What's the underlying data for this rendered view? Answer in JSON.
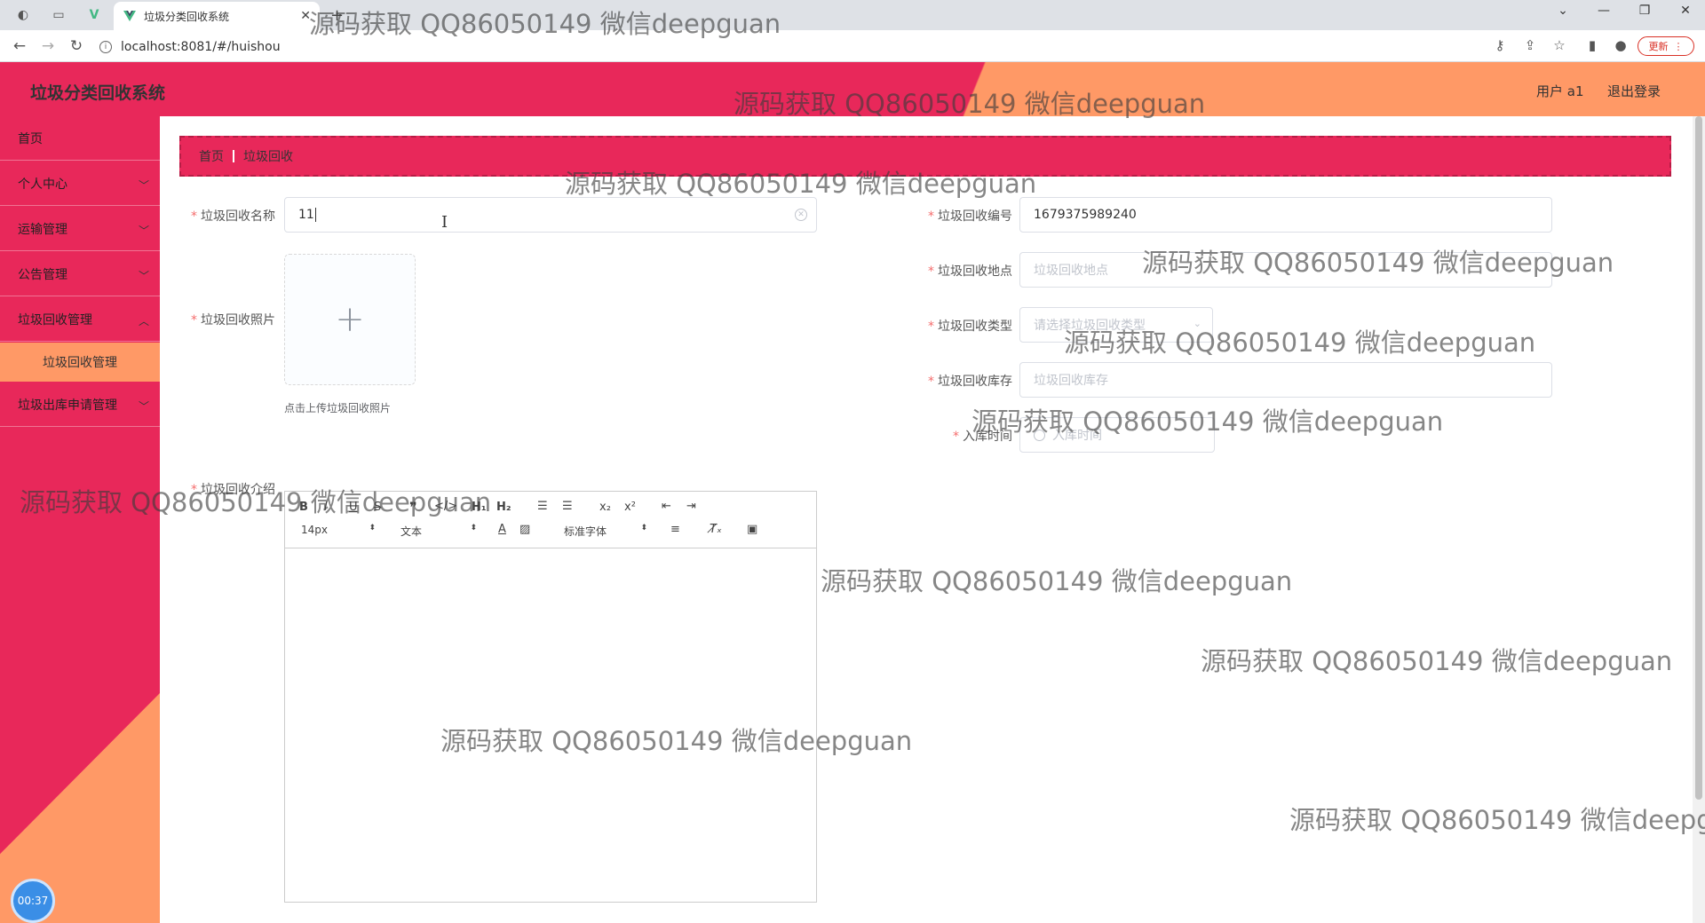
{
  "browser": {
    "tab_title": "垃圾分类回收系统",
    "url": "localhost:8081/#/huishou",
    "update_label": "更新"
  },
  "header": {
    "app_title": "垃圾分类回收系统",
    "user_label": "用户 a1",
    "logout_label": "退出登录"
  },
  "sidebar": {
    "items": [
      {
        "label": "首页",
        "expandable": false
      },
      {
        "label": "个人中心",
        "expandable": true
      },
      {
        "label": "运输管理",
        "expandable": true
      },
      {
        "label": "公告管理",
        "expandable": true
      },
      {
        "label": "垃圾回收管理",
        "expandable": true
      },
      {
        "label": "垃圾出库申请管理",
        "expandable": true
      }
    ],
    "active_sub_item": "垃圾回收管理",
    "timer": "00:37"
  },
  "breadcrumb": [
    "首页",
    "垃圾回收"
  ],
  "form": {
    "name": {
      "label": "垃圾回收名称",
      "value": "11"
    },
    "photo": {
      "label": "垃圾回收照片",
      "tip": "点击上传垃圾回收照片"
    },
    "intro": {
      "label": "垃圾回收介绍"
    },
    "code": {
      "label": "垃圾回收编号",
      "value": "1679375989240"
    },
    "location": {
      "label": "垃圾回收地点",
      "placeholder": "垃圾回收地点"
    },
    "type": {
      "label": "垃圾回收类型",
      "placeholder": "请选择垃圾回收类型"
    },
    "stock": {
      "label": "垃圾回收库存",
      "placeholder": "垃圾回收库存"
    },
    "time": {
      "label": "入库时间",
      "placeholder": "入库时间"
    }
  },
  "editor": {
    "font_size": "14px",
    "text_type": "文本",
    "font_family": "标准字体"
  },
  "watermark": "源码获取 QQ86050149 微信deepguan",
  "colors": {
    "primary": "#e8285a",
    "accent": "#ff9966"
  }
}
